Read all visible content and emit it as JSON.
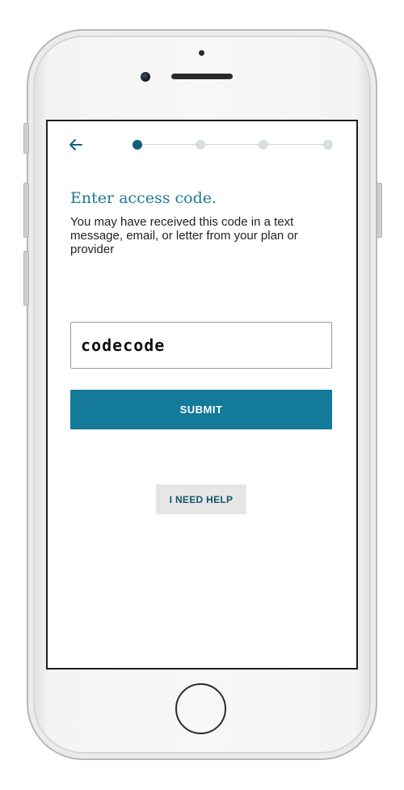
{
  "colors": {
    "accent": "#137a99",
    "title": "#1c7a98",
    "step_active": "#13607c",
    "step_inactive": "#d7dee0",
    "help_text": "#13566b",
    "help_bg": "#e6e6e6"
  },
  "header": {
    "back_icon": "arrow-left-icon",
    "stepper": {
      "current_step": 1,
      "total_steps": 4
    }
  },
  "main": {
    "title": "Enter access code.",
    "subtitle": "You may have received this code in a text message, email, or letter from your plan or provider",
    "code_input": {
      "value": "codecode"
    },
    "submit_label": "SUBMIT",
    "help_label": "I NEED HELP"
  }
}
